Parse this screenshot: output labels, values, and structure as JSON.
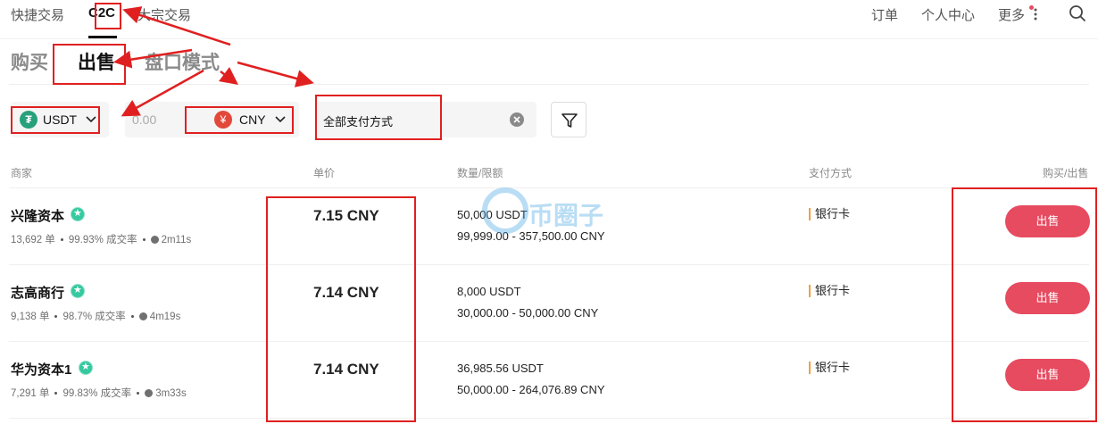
{
  "nav": {
    "tabs": [
      {
        "label": "快捷交易"
      },
      {
        "label": "C2C"
      },
      {
        "label": "大宗交易"
      }
    ],
    "right": {
      "orders": "订单",
      "profile": "个人中心",
      "more": "更多"
    }
  },
  "mode_tabs": [
    {
      "label": "购买"
    },
    {
      "label": "出售"
    },
    {
      "label": "盘口模式"
    }
  ],
  "filters": {
    "coin": "USDT",
    "coin_icon": "tether-icon",
    "amount_placeholder": "0.00",
    "fiat": "CNY",
    "fiat_icon": "yuan-icon",
    "fiat_symbol": "¥",
    "payment_method": "全部支付方式"
  },
  "table": {
    "headers": {
      "merchant": "商家",
      "price": "单价",
      "amount": "数量/限额",
      "payment": "支付方式",
      "action": "购买/出售"
    },
    "rows": [
      {
        "merchant": "兴隆资本",
        "orders": "13,692 单",
        "rate": "99.93% 成交率",
        "time": "2m11s",
        "price": "7.15 CNY",
        "qty": "50,000 USDT",
        "limit": "99,999.00 - 357,500.00 CNY",
        "payment": "银行卡",
        "action": "出售"
      },
      {
        "merchant": "志高商行",
        "orders": "9,138 单",
        "rate": "98.7% 成交率",
        "time": "4m19s",
        "price": "7.14 CNY",
        "qty": "8,000 USDT",
        "limit": "30,000.00 - 50,000.00 CNY",
        "payment": "银行卡",
        "action": "出售"
      },
      {
        "merchant": "华为资本1",
        "orders": "7,291 单",
        "rate": "99.83% 成交率",
        "time": "3m33s",
        "price": "7.14 CNY",
        "qty": "36,985.56 USDT",
        "limit": "50,000.00 - 264,076.89 CNY",
        "payment": "银行卡",
        "action": "出售"
      }
    ]
  },
  "watermark": "币圈子",
  "colors": {
    "accent": "#e64b60",
    "annotation": "#e02020",
    "tether": "#26a17b",
    "verified": "#35c9a0"
  }
}
